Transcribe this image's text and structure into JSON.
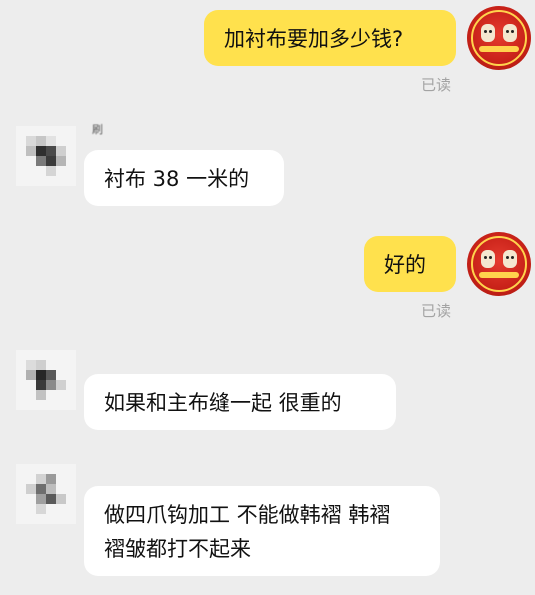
{
  "messages": [
    {
      "direction": "out",
      "text": "加衬布要加多少钱?",
      "status": "已读"
    },
    {
      "direction": "in",
      "sender_tag": "刷",
      "text": "衬布 38 一米的"
    },
    {
      "direction": "out",
      "text": "好的",
      "status": "已读"
    },
    {
      "direction": "in",
      "text": "如果和主布缝一起 很重的"
    },
    {
      "direction": "in",
      "text": "做四爪钩加工 不能做韩褶 韩褶褶皱都打不起来"
    }
  ],
  "colors": {
    "background": "#ededed",
    "outgoing_bubble": "#ffe14d",
    "incoming_bubble": "#ffffff",
    "status_text": "#a3a3a3"
  },
  "icons": {
    "self_avatar": "red-cartoon-avatar-icon",
    "contact_avatar": "pixelated-avatar-icon"
  }
}
